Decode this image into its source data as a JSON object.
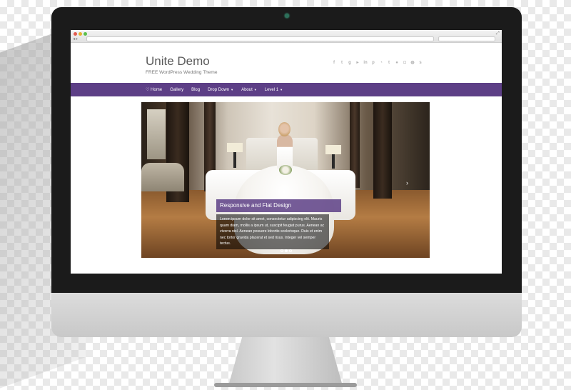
{
  "site": {
    "title": "Unite Demo",
    "tagline": "FREE WordPress Wedding Theme"
  },
  "social_icons": [
    "facebook-icon",
    "twitter-icon",
    "google-plus-icon",
    "youtube-icon",
    "linkedin-icon",
    "pinterest-icon",
    "rss-icon",
    "tumblr-icon",
    "flickr-icon",
    "instagram-icon",
    "dribbble-icon",
    "skype-icon"
  ],
  "menu": {
    "home_label": "Home",
    "gallery_label": "Gallery",
    "blog_label": "Blog",
    "dropdown_label": "Drop Down",
    "about_label": "About",
    "level1_label": "Level 1"
  },
  "slider": {
    "caption_title": "Responsive and Flat Design",
    "caption_text": "Lorem ipsum dolor sit amet, consectetur adipiscing elit. Mauris quam diam, mollis a ipsum ut, suscipit feugiat purus. Aenean ac viverra nisl. Aenean posuere lobortis scelerisque. Duis et enim nec tortor gravida placerat et sed risus. Integer vel semper tectus.",
    "active_slide": 2,
    "slide_count": 3
  },
  "colors": {
    "accent": "#5d3f86"
  }
}
